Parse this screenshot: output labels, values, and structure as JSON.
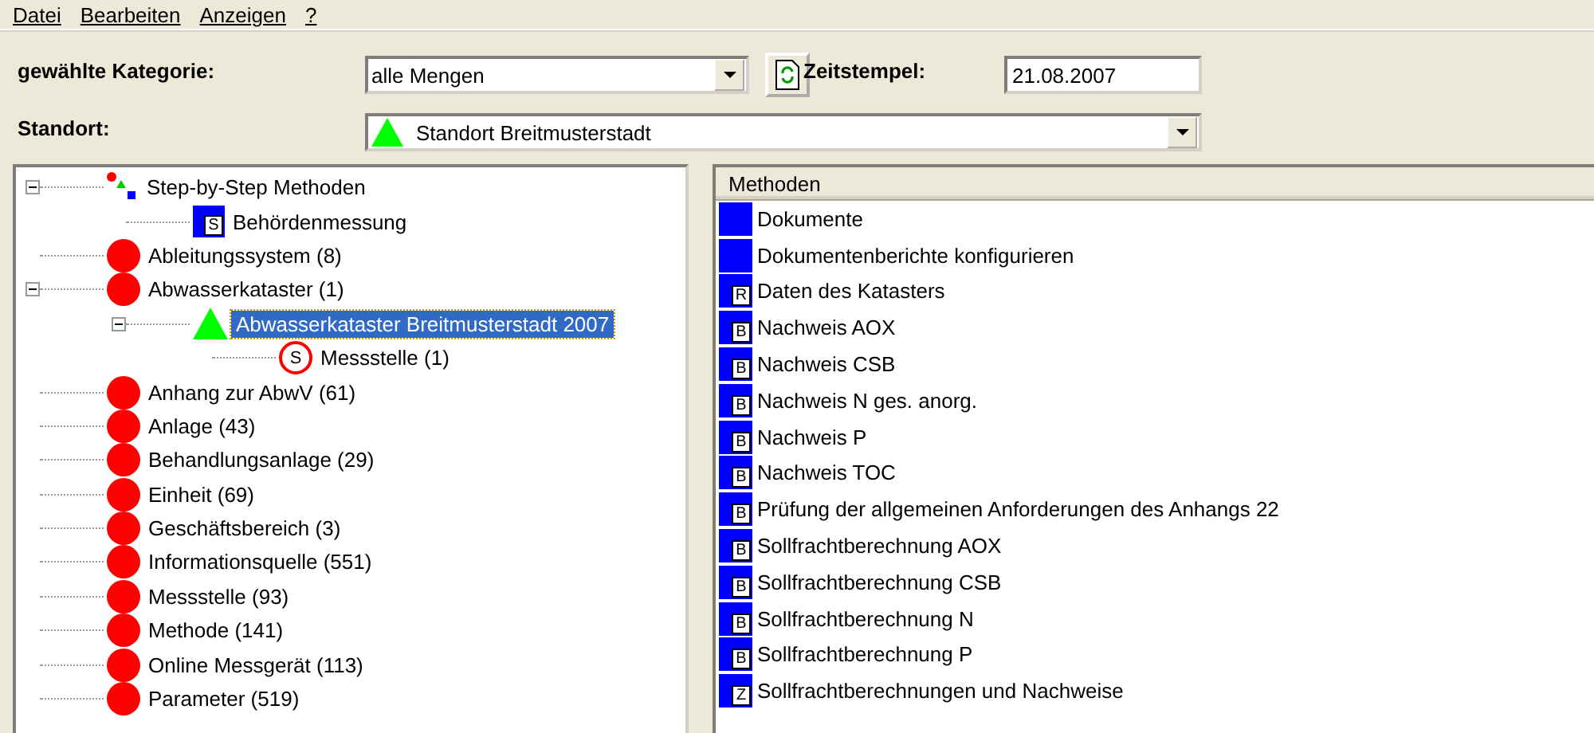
{
  "menu": [
    "Datei",
    "Bearbeiten",
    "Anzeigen",
    "?"
  ],
  "filter": {
    "category_label": "gewählte Kategorie:",
    "category_value": "alle Mengen",
    "timestamp_label": "Zeitstempel:",
    "timestamp_value": "21.08.2007",
    "location_label": "Standort:",
    "location_value": "Standort Breitmusterstadt"
  },
  "tree": [
    {
      "label": "Step-by-Step Methoden",
      "kind": "steps",
      "expanded": true,
      "selected": false,
      "children": [
        {
          "label": "Behördenmessung",
          "kind": "square",
          "badge": "S",
          "selected": false
        }
      ]
    },
    {
      "label": "Ableitungssystem (8)",
      "kind": "dot",
      "selected": false
    },
    {
      "label": "Abwasserkataster (1)",
      "kind": "dot",
      "expanded": true,
      "selected": false,
      "children": [
        {
          "label": "Abwasserkataster Breitmusterstadt 2007",
          "kind": "triangle",
          "expanded": true,
          "selected": true,
          "children": [
            {
              "label": "Messstelle (1)",
              "kind": "ring",
              "badge": "S",
              "selected": false
            }
          ]
        }
      ]
    },
    {
      "label": "Anhang zur AbwV (61)",
      "kind": "dot",
      "selected": false
    },
    {
      "label": "Anlage (43)",
      "kind": "dot",
      "selected": false
    },
    {
      "label": "Behandlungsanlage (29)",
      "kind": "dot",
      "selected": false
    },
    {
      "label": "Einheit (69)",
      "kind": "dot",
      "selected": false
    },
    {
      "label": "Geschäftsbereich (3)",
      "kind": "dot",
      "selected": false
    },
    {
      "label": "Informationsquelle (551)",
      "kind": "dot",
      "selected": false
    },
    {
      "label": "Messstelle (93)",
      "kind": "dot",
      "selected": false
    },
    {
      "label": "Methode (141)",
      "kind": "dot",
      "selected": false
    },
    {
      "label": "Online Messgerät (113)",
      "kind": "dot",
      "selected": false
    },
    {
      "label": "Parameter (519)",
      "kind": "dot",
      "selected": false
    }
  ],
  "methods": {
    "column": "Methoden",
    "rows": [
      {
        "label": "Dokumente"
      },
      {
        "label": "Dokumentenberichte konfigurieren"
      },
      {
        "badge": "R",
        "label": "Daten des Katasters"
      },
      {
        "badge": "B",
        "label": "Nachweis AOX"
      },
      {
        "badge": "B",
        "label": "Nachweis CSB"
      },
      {
        "badge": "B",
        "label": "Nachweis N ges. anorg."
      },
      {
        "badge": "B",
        "label": "Nachweis P"
      },
      {
        "badge": "B",
        "label": "Nachweis TOC"
      },
      {
        "badge": "B",
        "label": "Prüfung der allgemeinen Anforderungen des Anhangs 22"
      },
      {
        "badge": "B",
        "label": "Sollfrachtberechnung AOX"
      },
      {
        "badge": "B",
        "label": "Sollfrachtberechnung CSB"
      },
      {
        "badge": "B",
        "label": "Sollfrachtberechnung N"
      },
      {
        "badge": "B",
        "label": "Sollfrachtberechnung P"
      },
      {
        "badge": "Z",
        "label": "Sollfrachtberechnungen und Nachweise"
      }
    ]
  }
}
